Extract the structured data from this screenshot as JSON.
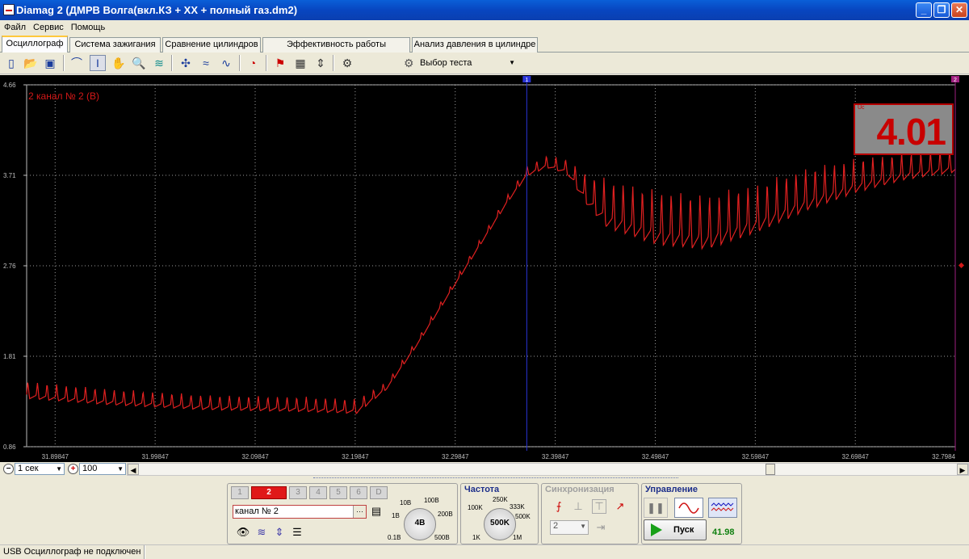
{
  "window": {
    "title": "Diamag 2 (ДМРВ Волга(вкл.КЗ + XX + полный газ.dm2)"
  },
  "menu": [
    "Файл",
    "Сервис",
    "Помощь"
  ],
  "tabs": [
    "Осциллограф",
    "Система зажигания",
    "Сравнение цилиндров",
    "Эффективность работы цилиндров",
    "Анализ давления в цилиндре"
  ],
  "active_tab": "Осциллограф",
  "toolbar": {
    "test_select": "Выбор теста"
  },
  "scope": {
    "channel_label": "2 канал № 2 (В)",
    "readout_value": "4.01",
    "readout_small": "Uc",
    "cursor1_label": "1",
    "cursor2_label": "2",
    "colors": {
      "trace": "#e02020",
      "cursor": "#2a34d8",
      "background": "#000000"
    }
  },
  "chart_data": {
    "type": "line",
    "title": "",
    "xlabel": "",
    "ylabel": "",
    "y_ticks": [
      "4.66",
      "3.71",
      "2.76",
      "1.81",
      "0.86"
    ],
    "x_ticks": [
      "31.89847",
      "31.99847",
      "32.09847",
      "32.19847",
      "32.29847",
      "32.39847",
      "32.49847",
      "32.59847",
      "32.69847",
      "32.7984"
    ],
    "ylim": [
      0.86,
      4.66
    ],
    "xlim": [
      31.87,
      32.7984
    ],
    "cursor_x": 32.37,
    "series": [
      {
        "x": [
          31.87,
          31.95,
          32.05,
          32.15,
          32.2,
          32.23,
          32.26,
          32.29,
          32.32,
          32.35,
          32.37,
          32.39,
          32.41,
          32.43,
          32.45,
          32.5,
          32.55,
          32.6,
          32.65,
          32.7,
          32.75,
          32.7984
        ],
        "y": [
          1.45,
          1.38,
          1.32,
          1.3,
          1.28,
          1.5,
          1.95,
          2.45,
          2.95,
          3.45,
          3.75,
          3.85,
          3.8,
          3.55,
          3.4,
          3.25,
          3.2,
          3.35,
          3.55,
          3.7,
          3.8,
          3.85
        ],
        "ripple": [
          0.14,
          0.13,
          0.12,
          0.12,
          0.12,
          0.06,
          0.05,
          0.05,
          0.05,
          0.06,
          0.08,
          0.1,
          0.12,
          0.25,
          0.4,
          0.45,
          0.45,
          0.4,
          0.35,
          0.28,
          0.22,
          0.18
        ]
      }
    ]
  },
  "timebase": {
    "value": "1 сек",
    "zoom": "100"
  },
  "channels": {
    "title": "",
    "buttons": [
      "1",
      "2",
      "3",
      "4",
      "5",
      "6",
      "D"
    ],
    "active": "2",
    "name": "канал № 2",
    "range_dial": "4В",
    "range_scale": [
      "0.1В",
      "1В",
      "10В",
      "100В",
      "200В",
      "500В"
    ]
  },
  "frequency": {
    "title": "Частота",
    "dial": "500K",
    "scale": [
      "1K",
      "100K",
      "250K",
      "333K",
      "500K",
      "1M"
    ]
  },
  "sync": {
    "title": "Синхронизация",
    "value": "2"
  },
  "control": {
    "title": "Управление",
    "start": "Пуск",
    "time": "41.98"
  },
  "status": {
    "text": "USB Осциллограф не подключен"
  }
}
